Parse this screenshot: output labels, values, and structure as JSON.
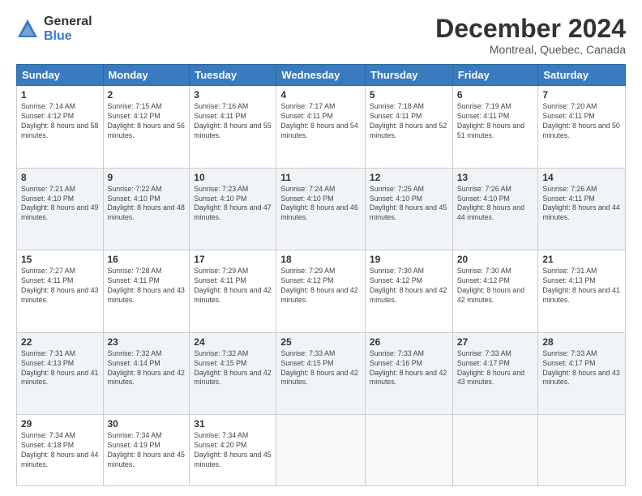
{
  "header": {
    "logo_general": "General",
    "logo_blue": "Blue",
    "month_title": "December 2024",
    "location": "Montreal, Quebec, Canada"
  },
  "days_of_week": [
    "Sunday",
    "Monday",
    "Tuesday",
    "Wednesday",
    "Thursday",
    "Friday",
    "Saturday"
  ],
  "weeks": [
    [
      {
        "day": "1",
        "sunrise": "Sunrise: 7:14 AM",
        "sunset": "Sunset: 4:12 PM",
        "daylight": "Daylight: 8 hours and 58 minutes."
      },
      {
        "day": "2",
        "sunrise": "Sunrise: 7:15 AM",
        "sunset": "Sunset: 4:12 PM",
        "daylight": "Daylight: 8 hours and 56 minutes."
      },
      {
        "day": "3",
        "sunrise": "Sunrise: 7:16 AM",
        "sunset": "Sunset: 4:11 PM",
        "daylight": "Daylight: 8 hours and 55 minutes."
      },
      {
        "day": "4",
        "sunrise": "Sunrise: 7:17 AM",
        "sunset": "Sunset: 4:11 PM",
        "daylight": "Daylight: 8 hours and 54 minutes."
      },
      {
        "day": "5",
        "sunrise": "Sunrise: 7:18 AM",
        "sunset": "Sunset: 4:11 PM",
        "daylight": "Daylight: 8 hours and 52 minutes."
      },
      {
        "day": "6",
        "sunrise": "Sunrise: 7:19 AM",
        "sunset": "Sunset: 4:11 PM",
        "daylight": "Daylight: 8 hours and 51 minutes."
      },
      {
        "day": "7",
        "sunrise": "Sunrise: 7:20 AM",
        "sunset": "Sunset: 4:11 PM",
        "daylight": "Daylight: 8 hours and 50 minutes."
      }
    ],
    [
      {
        "day": "8",
        "sunrise": "Sunrise: 7:21 AM",
        "sunset": "Sunset: 4:10 PM",
        "daylight": "Daylight: 8 hours and 49 minutes."
      },
      {
        "day": "9",
        "sunrise": "Sunrise: 7:22 AM",
        "sunset": "Sunset: 4:10 PM",
        "daylight": "Daylight: 8 hours and 48 minutes."
      },
      {
        "day": "10",
        "sunrise": "Sunrise: 7:23 AM",
        "sunset": "Sunset: 4:10 PM",
        "daylight": "Daylight: 8 hours and 47 minutes."
      },
      {
        "day": "11",
        "sunrise": "Sunrise: 7:24 AM",
        "sunset": "Sunset: 4:10 PM",
        "daylight": "Daylight: 8 hours and 46 minutes."
      },
      {
        "day": "12",
        "sunrise": "Sunrise: 7:25 AM",
        "sunset": "Sunset: 4:10 PM",
        "daylight": "Daylight: 8 hours and 45 minutes."
      },
      {
        "day": "13",
        "sunrise": "Sunrise: 7:26 AM",
        "sunset": "Sunset: 4:10 PM",
        "daylight": "Daylight: 8 hours and 44 minutes."
      },
      {
        "day": "14",
        "sunrise": "Sunrise: 7:26 AM",
        "sunset": "Sunset: 4:11 PM",
        "daylight": "Daylight: 8 hours and 44 minutes."
      }
    ],
    [
      {
        "day": "15",
        "sunrise": "Sunrise: 7:27 AM",
        "sunset": "Sunset: 4:11 PM",
        "daylight": "Daylight: 8 hours and 43 minutes."
      },
      {
        "day": "16",
        "sunrise": "Sunrise: 7:28 AM",
        "sunset": "Sunset: 4:11 PM",
        "daylight": "Daylight: 8 hours and 43 minutes."
      },
      {
        "day": "17",
        "sunrise": "Sunrise: 7:29 AM",
        "sunset": "Sunset: 4:11 PM",
        "daylight": "Daylight: 8 hours and 42 minutes."
      },
      {
        "day": "18",
        "sunrise": "Sunrise: 7:29 AM",
        "sunset": "Sunset: 4:12 PM",
        "daylight": "Daylight: 8 hours and 42 minutes."
      },
      {
        "day": "19",
        "sunrise": "Sunrise: 7:30 AM",
        "sunset": "Sunset: 4:12 PM",
        "daylight": "Daylight: 8 hours and 42 minutes."
      },
      {
        "day": "20",
        "sunrise": "Sunrise: 7:30 AM",
        "sunset": "Sunset: 4:12 PM",
        "daylight": "Daylight: 8 hours and 42 minutes."
      },
      {
        "day": "21",
        "sunrise": "Sunrise: 7:31 AM",
        "sunset": "Sunset: 4:13 PM",
        "daylight": "Daylight: 8 hours and 41 minutes."
      }
    ],
    [
      {
        "day": "22",
        "sunrise": "Sunrise: 7:31 AM",
        "sunset": "Sunset: 4:13 PM",
        "daylight": "Daylight: 8 hours and 41 minutes."
      },
      {
        "day": "23",
        "sunrise": "Sunrise: 7:32 AM",
        "sunset": "Sunset: 4:14 PM",
        "daylight": "Daylight: 8 hours and 42 minutes."
      },
      {
        "day": "24",
        "sunrise": "Sunrise: 7:32 AM",
        "sunset": "Sunset: 4:15 PM",
        "daylight": "Daylight: 8 hours and 42 minutes."
      },
      {
        "day": "25",
        "sunrise": "Sunrise: 7:33 AM",
        "sunset": "Sunset: 4:15 PM",
        "daylight": "Daylight: 8 hours and 42 minutes."
      },
      {
        "day": "26",
        "sunrise": "Sunrise: 7:33 AM",
        "sunset": "Sunset: 4:16 PM",
        "daylight": "Daylight: 8 hours and 42 minutes."
      },
      {
        "day": "27",
        "sunrise": "Sunrise: 7:33 AM",
        "sunset": "Sunset: 4:17 PM",
        "daylight": "Daylight: 8 hours and 43 minutes."
      },
      {
        "day": "28",
        "sunrise": "Sunrise: 7:33 AM",
        "sunset": "Sunset: 4:17 PM",
        "daylight": "Daylight: 8 hours and 43 minutes."
      }
    ],
    [
      {
        "day": "29",
        "sunrise": "Sunrise: 7:34 AM",
        "sunset": "Sunset: 4:18 PM",
        "daylight": "Daylight: 8 hours and 44 minutes."
      },
      {
        "day": "30",
        "sunrise": "Sunrise: 7:34 AM",
        "sunset": "Sunset: 4:19 PM",
        "daylight": "Daylight: 8 hours and 45 minutes."
      },
      {
        "day": "31",
        "sunrise": "Sunrise: 7:34 AM",
        "sunset": "Sunset: 4:20 PM",
        "daylight": "Daylight: 8 hours and 45 minutes."
      },
      null,
      null,
      null,
      null
    ]
  ]
}
